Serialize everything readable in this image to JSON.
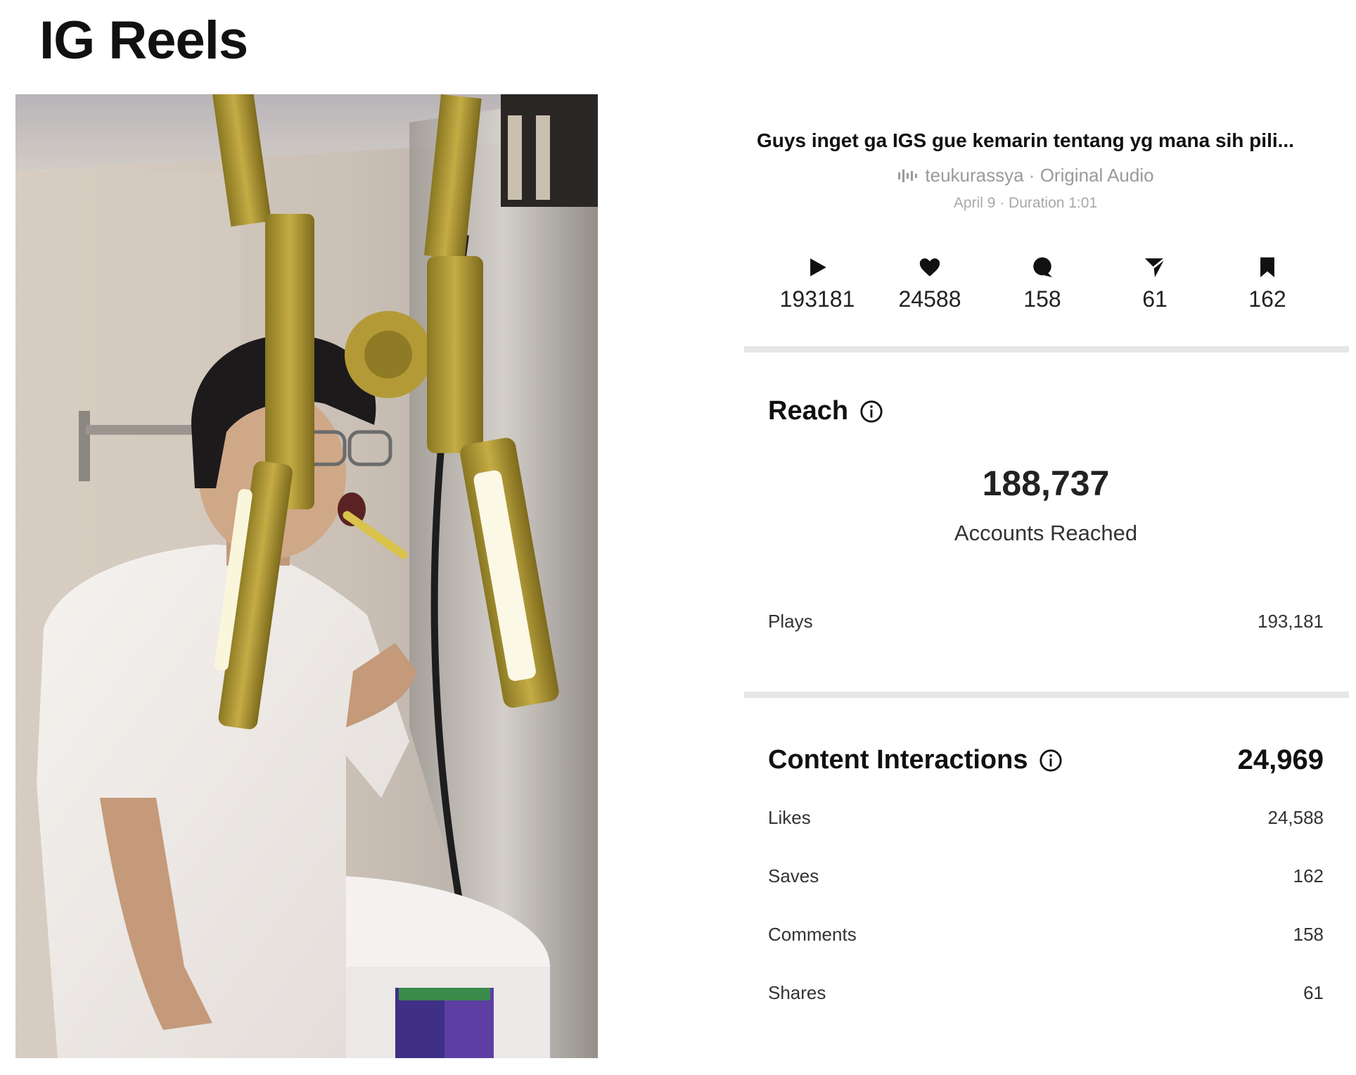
{
  "page": {
    "title": "IG Reels"
  },
  "reel": {
    "caption": "Guys inget ga IGS gue kemarin tentang yg mana sih pili...",
    "audio": "teukurassya · Original Audio",
    "meta": "April 9 · Duration 1:01"
  },
  "stats": [
    {
      "icon": "play-icon",
      "value": "193181"
    },
    {
      "icon": "heart-icon",
      "value": "24588"
    },
    {
      "icon": "comment-icon",
      "value": "158"
    },
    {
      "icon": "share-icon",
      "value": "61"
    },
    {
      "icon": "bookmark-icon",
      "value": "162"
    }
  ],
  "reach": {
    "title": "Reach",
    "accounts_reached_value": "188,737",
    "accounts_reached_label": "Accounts Reached",
    "plays_label": "Plays",
    "plays_value": "193,181"
  },
  "content_interactions": {
    "title": "Content Interactions",
    "total": "24,969",
    "rows": [
      {
        "label": "Likes",
        "value": "24,588"
      },
      {
        "label": "Saves",
        "value": "162"
      },
      {
        "label": "Comments",
        "value": "158"
      },
      {
        "label": "Shares",
        "value": "61"
      }
    ]
  },
  "colors": {
    "divider": "#e6e6e6",
    "muted_text": "#9a9a9a",
    "text": "#111111"
  }
}
